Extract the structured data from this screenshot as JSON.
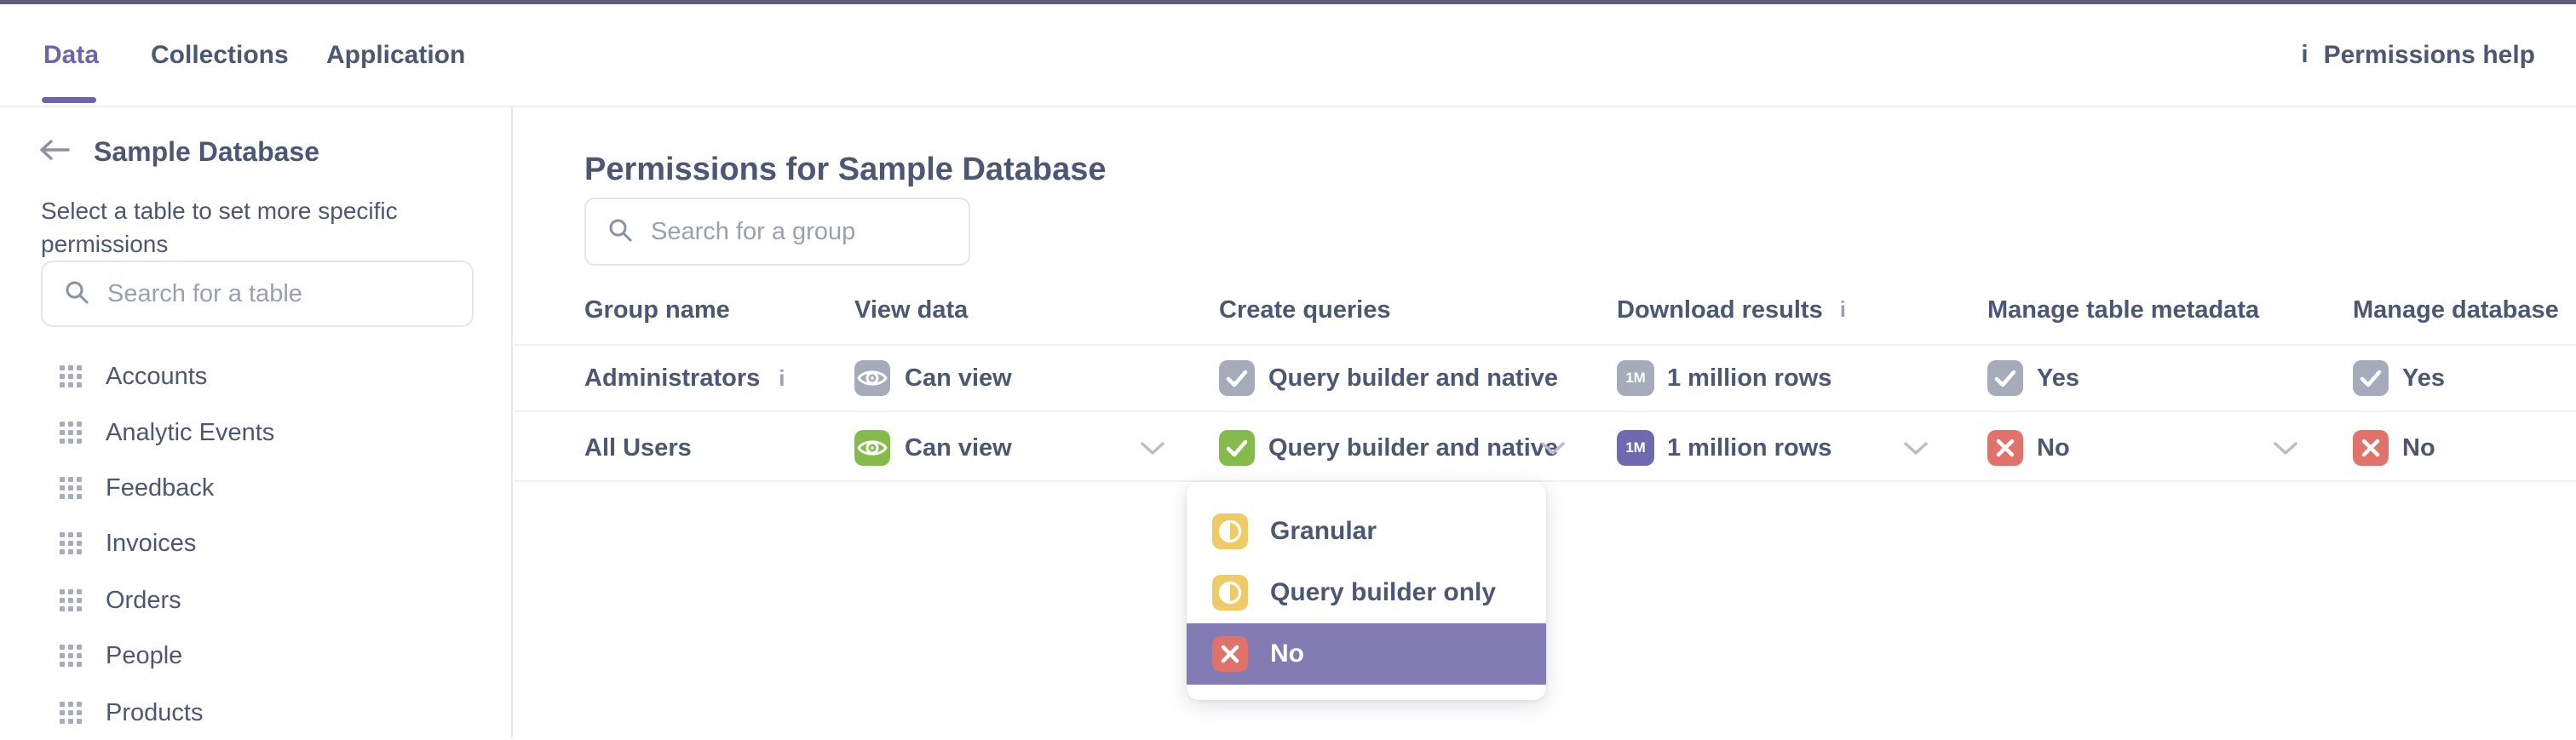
{
  "colors": {
    "topbar": "#615D81",
    "brand_purple": "#6A66A8",
    "success_green": "#84BB4C",
    "warning_yellow": "#EFCB67",
    "danger_red": "#E0716B",
    "accent_purple": "#6F6AB0",
    "neutral_gray": "#A5ABBB",
    "selected_row_bg": "#837BB3",
    "text": "#4C5773"
  },
  "topnav": {
    "tabs": [
      {
        "label": "Data"
      },
      {
        "label": "Collections"
      },
      {
        "label": "Application"
      }
    ],
    "active_tab": "Data",
    "help_label": "Permissions help",
    "info_glyph": "i"
  },
  "sidebar": {
    "back_title": "Sample Database",
    "description": "Select a table to set more specific permissions",
    "search_placeholder": "Search for a table",
    "tables": [
      {
        "label": "Accounts"
      },
      {
        "label": "Analytic Events"
      },
      {
        "label": "Feedback"
      },
      {
        "label": "Invoices"
      },
      {
        "label": "Orders"
      },
      {
        "label": "People"
      },
      {
        "label": "Products"
      }
    ]
  },
  "main": {
    "title": "Permissions for Sample Database",
    "search_placeholder": "Search for a group",
    "columns": [
      {
        "label": "Group name"
      },
      {
        "label": "View data"
      },
      {
        "label": "Create queries"
      },
      {
        "label": "Download results",
        "info_glyph": "i"
      },
      {
        "label": "Manage table metadata"
      },
      {
        "label": "Manage database"
      }
    ],
    "million_badge": "1M",
    "rows": [
      {
        "group": "Administrators",
        "info_glyph": "i",
        "cells": [
          {
            "label": "Can view"
          },
          {
            "label": "Query builder and native"
          },
          {
            "label": "1 million rows"
          },
          {
            "label": "Yes"
          },
          {
            "label": "Yes"
          }
        ]
      },
      {
        "group": "All Users",
        "cells": [
          {
            "label": "Can view"
          },
          {
            "label": "Query builder and native"
          },
          {
            "label": "1 million rows"
          },
          {
            "label": "No"
          },
          {
            "label": "No"
          }
        ]
      }
    ],
    "dropdown": {
      "items": [
        {
          "label": "Granular",
          "selected": false
        },
        {
          "label": "Query builder only",
          "selected": false
        },
        {
          "label": "No",
          "selected": true
        }
      ]
    }
  }
}
